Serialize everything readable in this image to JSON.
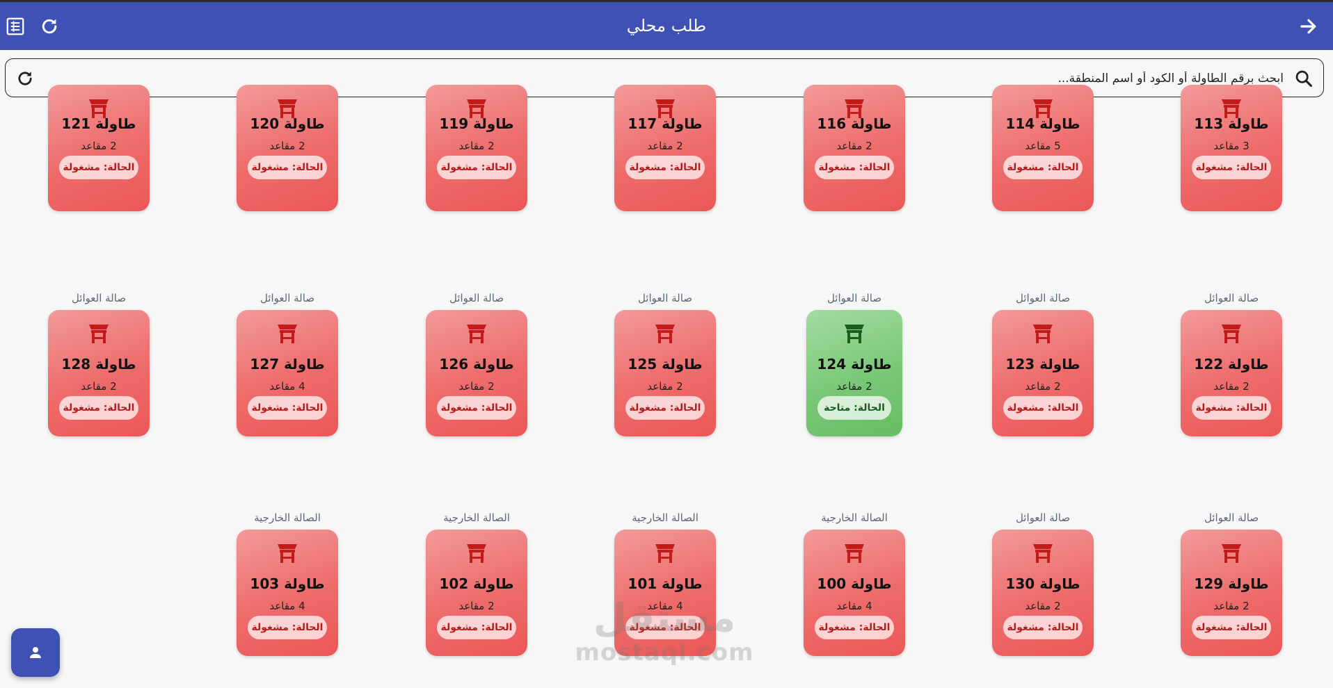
{
  "header": {
    "title": "طلب محلي",
    "left_icons": [
      "list-icon",
      "refresh-icon"
    ],
    "right_icon": "arrow-forward-icon",
    "bg_color": "#3f51b5"
  },
  "search": {
    "placeholder": "ابحث برقم الطاولة أو الكود أو اسم المنطقة...",
    "value": ""
  },
  "colors": {
    "busy": "#ef6b6b",
    "free": "#7ac877",
    "busy_icon": "#c41a1a",
    "free_icon": "#1a5e1a"
  },
  "tables": [
    {
      "zone": "",
      "name": "طاولة 113",
      "seats": "3 مقاعد",
      "status": "الحالة: مشغولة",
      "state": "busy"
    },
    {
      "zone": "",
      "name": "طاولة 114",
      "seats": "5 مقاعد",
      "status": "الحالة: مشغولة",
      "state": "busy"
    },
    {
      "zone": "",
      "name": "طاولة 116",
      "seats": "2 مقاعد",
      "status": "الحالة: مشغولة",
      "state": "busy"
    },
    {
      "zone": "",
      "name": "طاولة 117",
      "seats": "2 مقاعد",
      "status": "الحالة: مشغولة",
      "state": "busy"
    },
    {
      "zone": "",
      "name": "طاولة 119",
      "seats": "2 مقاعد",
      "status": "الحالة: مشغولة",
      "state": "busy"
    },
    {
      "zone": "",
      "name": "طاولة 120",
      "seats": "2 مقاعد",
      "status": "الحالة: مشغولة",
      "state": "busy"
    },
    {
      "zone": "",
      "name": "طاولة 121",
      "seats": "2 مقاعد",
      "status": "الحالة: مشغولة",
      "state": "busy"
    },
    {
      "zone": "صالة العوائل",
      "name": "طاولة 122",
      "seats": "2 مقاعد",
      "status": "الحالة: مشغولة",
      "state": "busy"
    },
    {
      "zone": "صالة العوائل",
      "name": "طاولة 123",
      "seats": "2 مقاعد",
      "status": "الحالة: مشغولة",
      "state": "busy"
    },
    {
      "zone": "صالة العوائل",
      "name": "طاولة 124",
      "seats": "2 مقاعد",
      "status": "الحالة: متاحة",
      "state": "free"
    },
    {
      "zone": "صالة العوائل",
      "name": "طاولة 125",
      "seats": "2 مقاعد",
      "status": "الحالة: مشغولة",
      "state": "busy"
    },
    {
      "zone": "صالة العوائل",
      "name": "طاولة 126",
      "seats": "2 مقاعد",
      "status": "الحالة: مشغولة",
      "state": "busy"
    },
    {
      "zone": "صالة العوائل",
      "name": "طاولة 127",
      "seats": "4 مقاعد",
      "status": "الحالة: مشغولة",
      "state": "busy"
    },
    {
      "zone": "صالة العوائل",
      "name": "طاولة 128",
      "seats": "2 مقاعد",
      "status": "الحالة: مشغولة",
      "state": "busy"
    },
    {
      "zone": "صالة العوائل",
      "name": "طاولة 129",
      "seats": "2 مقاعد",
      "status": "الحالة: مشغولة",
      "state": "busy"
    },
    {
      "zone": "صالة العوائل",
      "name": "طاولة 130",
      "seats": "2 مقاعد",
      "status": "الحالة: مشغولة",
      "state": "busy"
    },
    {
      "zone": "الصالة الخارجية",
      "name": "طاولة 100",
      "seats": "4 مقاعد",
      "status": "الحالة: مشغولة",
      "state": "busy"
    },
    {
      "zone": "الصالة الخارجية",
      "name": "طاولة 101",
      "seats": "4 مقاعد",
      "status": "الحالة: مشغولة",
      "state": "busy"
    },
    {
      "zone": "الصالة الخارجية",
      "name": "طاولة 102",
      "seats": "2 مقاعد",
      "status": "الحالة: مشغولة",
      "state": "busy"
    },
    {
      "zone": "الصالة الخارجية",
      "name": "طاولة 103",
      "seats": "4 مقاعد",
      "status": "الحالة: مشغولة",
      "state": "busy"
    }
  ],
  "fab": {
    "icon": "person-icon"
  },
  "watermark": {
    "logo_text": "مستقل",
    "domain": "mostaql.com"
  }
}
